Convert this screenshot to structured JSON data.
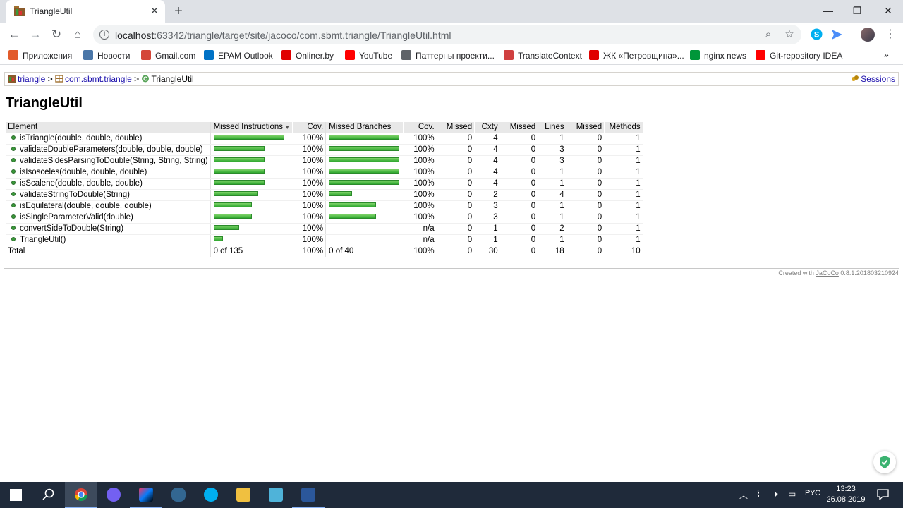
{
  "browser": {
    "tab_title": "TriangleUtil",
    "url_host": "localhost",
    "url_rest": ":63342/triangle/target/site/jacoco/com.sbmt.triangle/TriangleUtil.html",
    "bookmarks": [
      {
        "label": "Приложения",
        "icon": "apps-grid-icon",
        "color": "#e25b2b"
      },
      {
        "label": "Новости",
        "icon": "vk-icon",
        "color": "#4a76a8"
      },
      {
        "label": "Gmail.com",
        "icon": "gmail-icon",
        "color": "#d44638"
      },
      {
        "label": "EPAM Outlook",
        "icon": "outlook-icon",
        "color": "#0072c6"
      },
      {
        "label": "Onliner.by",
        "icon": "onliner-icon",
        "color": "#e00000"
      },
      {
        "label": "YouTube",
        "icon": "youtube-icon",
        "color": "#ff0000"
      },
      {
        "label": "Паттерны проекти...",
        "icon": "globe-icon",
        "color": "#5f6368"
      },
      {
        "label": "TranslateContext",
        "icon": "translate-icon",
        "color": "#d04040"
      },
      {
        "label": "ЖК «Петровщина»...",
        "icon": "info-icon",
        "color": "#e00000"
      },
      {
        "label": "nginx news",
        "icon": "nginx-icon",
        "color": "#009639"
      },
      {
        "label": "Git-repository IDEA",
        "icon": "youtube-icon",
        "color": "#ff0000"
      }
    ]
  },
  "report": {
    "breadcrumb": {
      "root": "triangle",
      "package": "com.sbmt.triangle",
      "current": "TriangleUtil",
      "sessions": "Sessions"
    },
    "title": "TriangleUtil",
    "headers": [
      "Element",
      "Missed Instructions",
      "Cov.",
      "Missed Branches",
      "Cov.",
      "Missed",
      "Cxty",
      "Missed",
      "Lines",
      "Missed",
      "Methods"
    ],
    "rows": [
      {
        "name": "isTriangle(double, double, double)",
        "instr": 1.0,
        "instr_cov": "100%",
        "br": 1.0,
        "br_cov": "100%",
        "mcx": "0",
        "cx": "4",
        "ml": "0",
        "l": "1",
        "mm": "0",
        "m": "1"
      },
      {
        "name": "validateDoubleParameters(double, double, double)",
        "instr": 0.72,
        "instr_cov": "100%",
        "br": 1.0,
        "br_cov": "100%",
        "mcx": "0",
        "cx": "4",
        "ml": "0",
        "l": "3",
        "mm": "0",
        "m": "1"
      },
      {
        "name": "validateSidesParsingToDouble(String, String, String)",
        "instr": 0.72,
        "instr_cov": "100%",
        "br": 1.0,
        "br_cov": "100%",
        "mcx": "0",
        "cx": "4",
        "ml": "0",
        "l": "3",
        "mm": "0",
        "m": "1"
      },
      {
        "name": "isIsosceles(double, double, double)",
        "instr": 0.72,
        "instr_cov": "100%",
        "br": 1.0,
        "br_cov": "100%",
        "mcx": "0",
        "cx": "4",
        "ml": "0",
        "l": "1",
        "mm": "0",
        "m": "1"
      },
      {
        "name": "isScalene(double, double, double)",
        "instr": 0.72,
        "instr_cov": "100%",
        "br": 1.0,
        "br_cov": "100%",
        "mcx": "0",
        "cx": "4",
        "ml": "0",
        "l": "1",
        "mm": "0",
        "m": "1"
      },
      {
        "name": "validateStringToDouble(String)",
        "instr": 0.63,
        "instr_cov": "100%",
        "br": 0.33,
        "br_cov": "100%",
        "mcx": "0",
        "cx": "2",
        "ml": "0",
        "l": "4",
        "mm": "0",
        "m": "1"
      },
      {
        "name": "isEquilateral(double, double, double)",
        "instr": 0.54,
        "instr_cov": "100%",
        "br": 0.67,
        "br_cov": "100%",
        "mcx": "0",
        "cx": "3",
        "ml": "0",
        "l": "1",
        "mm": "0",
        "m": "1"
      },
      {
        "name": "isSingleParameterValid(double)",
        "instr": 0.54,
        "instr_cov": "100%",
        "br": 0.67,
        "br_cov": "100%",
        "mcx": "0",
        "cx": "3",
        "ml": "0",
        "l": "1",
        "mm": "0",
        "m": "1"
      },
      {
        "name": "convertSideToDouble(String)",
        "instr": 0.36,
        "instr_cov": "100%",
        "br": 0,
        "br_cov": "n/a",
        "mcx": "0",
        "cx": "1",
        "ml": "0",
        "l": "2",
        "mm": "0",
        "m": "1"
      },
      {
        "name": "TriangleUtil()",
        "instr": 0.13,
        "instr_cov": "100%",
        "br": 0,
        "br_cov": "n/a",
        "mcx": "0",
        "cx": "1",
        "ml": "0",
        "l": "1",
        "mm": "0",
        "m": "1"
      }
    ],
    "total": {
      "label": "Total",
      "instr": "0 of 135",
      "instr_cov": "100%",
      "br": "0 of 40",
      "br_cov": "100%",
      "mcx": "0",
      "cx": "30",
      "ml": "0",
      "l": "18",
      "mm": "0",
      "m": "10"
    },
    "footer_prefix": "Created with",
    "footer_link": "JaCoCo",
    "footer_version": "0.8.1.201803210924"
  },
  "taskbar": {
    "lang": "РУС",
    "time": "13:23",
    "date": "26.08.2019"
  }
}
